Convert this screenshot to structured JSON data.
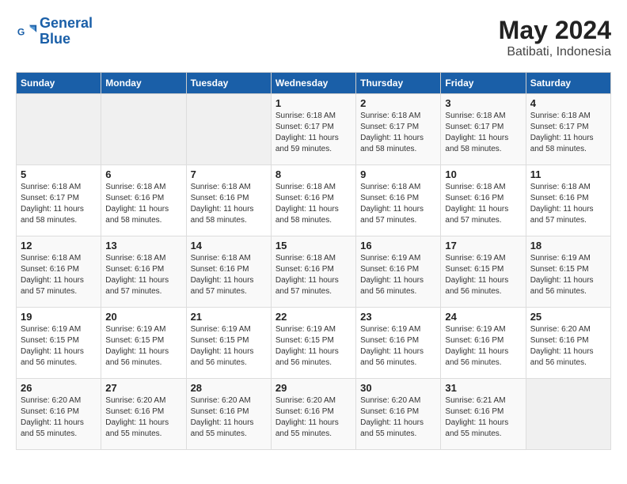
{
  "header": {
    "logo_line1": "General",
    "logo_line2": "Blue",
    "title": "May 2024",
    "subtitle": "Batibati, Indonesia"
  },
  "columns": [
    "Sunday",
    "Monday",
    "Tuesday",
    "Wednesday",
    "Thursday",
    "Friday",
    "Saturday"
  ],
  "weeks": [
    [
      {
        "day": "",
        "info": ""
      },
      {
        "day": "",
        "info": ""
      },
      {
        "day": "",
        "info": ""
      },
      {
        "day": "1",
        "info": "Sunrise: 6:18 AM\nSunset: 6:17 PM\nDaylight: 11 hours\nand 59 minutes."
      },
      {
        "day": "2",
        "info": "Sunrise: 6:18 AM\nSunset: 6:17 PM\nDaylight: 11 hours\nand 58 minutes."
      },
      {
        "day": "3",
        "info": "Sunrise: 6:18 AM\nSunset: 6:17 PM\nDaylight: 11 hours\nand 58 minutes."
      },
      {
        "day": "4",
        "info": "Sunrise: 6:18 AM\nSunset: 6:17 PM\nDaylight: 11 hours\nand 58 minutes."
      }
    ],
    [
      {
        "day": "5",
        "info": "Sunrise: 6:18 AM\nSunset: 6:17 PM\nDaylight: 11 hours\nand 58 minutes."
      },
      {
        "day": "6",
        "info": "Sunrise: 6:18 AM\nSunset: 6:16 PM\nDaylight: 11 hours\nand 58 minutes."
      },
      {
        "day": "7",
        "info": "Sunrise: 6:18 AM\nSunset: 6:16 PM\nDaylight: 11 hours\nand 58 minutes."
      },
      {
        "day": "8",
        "info": "Sunrise: 6:18 AM\nSunset: 6:16 PM\nDaylight: 11 hours\nand 58 minutes."
      },
      {
        "day": "9",
        "info": "Sunrise: 6:18 AM\nSunset: 6:16 PM\nDaylight: 11 hours\nand 57 minutes."
      },
      {
        "day": "10",
        "info": "Sunrise: 6:18 AM\nSunset: 6:16 PM\nDaylight: 11 hours\nand 57 minutes."
      },
      {
        "day": "11",
        "info": "Sunrise: 6:18 AM\nSunset: 6:16 PM\nDaylight: 11 hours\nand 57 minutes."
      }
    ],
    [
      {
        "day": "12",
        "info": "Sunrise: 6:18 AM\nSunset: 6:16 PM\nDaylight: 11 hours\nand 57 minutes."
      },
      {
        "day": "13",
        "info": "Sunrise: 6:18 AM\nSunset: 6:16 PM\nDaylight: 11 hours\nand 57 minutes."
      },
      {
        "day": "14",
        "info": "Sunrise: 6:18 AM\nSunset: 6:16 PM\nDaylight: 11 hours\nand 57 minutes."
      },
      {
        "day": "15",
        "info": "Sunrise: 6:18 AM\nSunset: 6:16 PM\nDaylight: 11 hours\nand 57 minutes."
      },
      {
        "day": "16",
        "info": "Sunrise: 6:19 AM\nSunset: 6:16 PM\nDaylight: 11 hours\nand 56 minutes."
      },
      {
        "day": "17",
        "info": "Sunrise: 6:19 AM\nSunset: 6:15 PM\nDaylight: 11 hours\nand 56 minutes."
      },
      {
        "day": "18",
        "info": "Sunrise: 6:19 AM\nSunset: 6:15 PM\nDaylight: 11 hours\nand 56 minutes."
      }
    ],
    [
      {
        "day": "19",
        "info": "Sunrise: 6:19 AM\nSunset: 6:15 PM\nDaylight: 11 hours\nand 56 minutes."
      },
      {
        "day": "20",
        "info": "Sunrise: 6:19 AM\nSunset: 6:15 PM\nDaylight: 11 hours\nand 56 minutes."
      },
      {
        "day": "21",
        "info": "Sunrise: 6:19 AM\nSunset: 6:15 PM\nDaylight: 11 hours\nand 56 minutes."
      },
      {
        "day": "22",
        "info": "Sunrise: 6:19 AM\nSunset: 6:15 PM\nDaylight: 11 hours\nand 56 minutes."
      },
      {
        "day": "23",
        "info": "Sunrise: 6:19 AM\nSunset: 6:16 PM\nDaylight: 11 hours\nand 56 minutes."
      },
      {
        "day": "24",
        "info": "Sunrise: 6:19 AM\nSunset: 6:16 PM\nDaylight: 11 hours\nand 56 minutes."
      },
      {
        "day": "25",
        "info": "Sunrise: 6:20 AM\nSunset: 6:16 PM\nDaylight: 11 hours\nand 56 minutes."
      }
    ],
    [
      {
        "day": "26",
        "info": "Sunrise: 6:20 AM\nSunset: 6:16 PM\nDaylight: 11 hours\nand 55 minutes."
      },
      {
        "day": "27",
        "info": "Sunrise: 6:20 AM\nSunset: 6:16 PM\nDaylight: 11 hours\nand 55 minutes."
      },
      {
        "day": "28",
        "info": "Sunrise: 6:20 AM\nSunset: 6:16 PM\nDaylight: 11 hours\nand 55 minutes."
      },
      {
        "day": "29",
        "info": "Sunrise: 6:20 AM\nSunset: 6:16 PM\nDaylight: 11 hours\nand 55 minutes."
      },
      {
        "day": "30",
        "info": "Sunrise: 6:20 AM\nSunset: 6:16 PM\nDaylight: 11 hours\nand 55 minutes."
      },
      {
        "day": "31",
        "info": "Sunrise: 6:21 AM\nSunset: 6:16 PM\nDaylight: 11 hours\nand 55 minutes."
      },
      {
        "day": "",
        "info": ""
      }
    ]
  ]
}
